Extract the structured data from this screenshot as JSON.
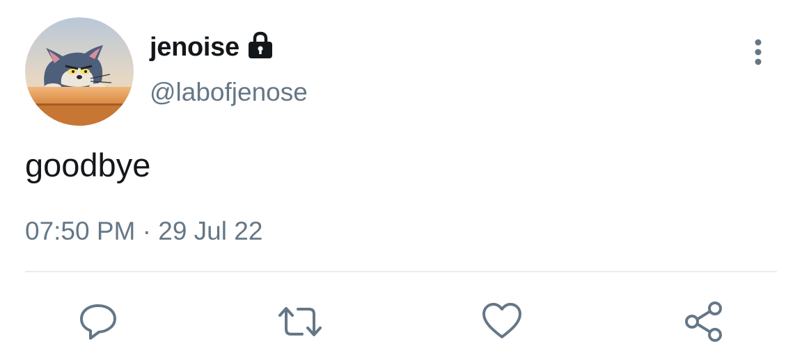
{
  "tweet": {
    "author": {
      "display_name": "jenoise",
      "handle": "@labofjenose",
      "protected_icon": "lock-icon",
      "avatar_icon": "avatar-cartoon-cat"
    },
    "text": "goodbye",
    "timestamp": "07:50 PM · 29 Jul 22"
  },
  "menu": {
    "more_icon": "vertical-ellipsis-icon"
  },
  "actions": [
    {
      "name": "reply",
      "icon": "speech-bubble-icon"
    },
    {
      "name": "retweet",
      "icon": "retweet-arrows-icon"
    },
    {
      "name": "like",
      "icon": "heart-icon"
    },
    {
      "name": "share",
      "icon": "share-nodes-icon"
    }
  ],
  "colors": {
    "primary_text": "#14171a",
    "secondary_text": "#657786",
    "icon": "#657786",
    "divider": "#e6ecf0"
  }
}
